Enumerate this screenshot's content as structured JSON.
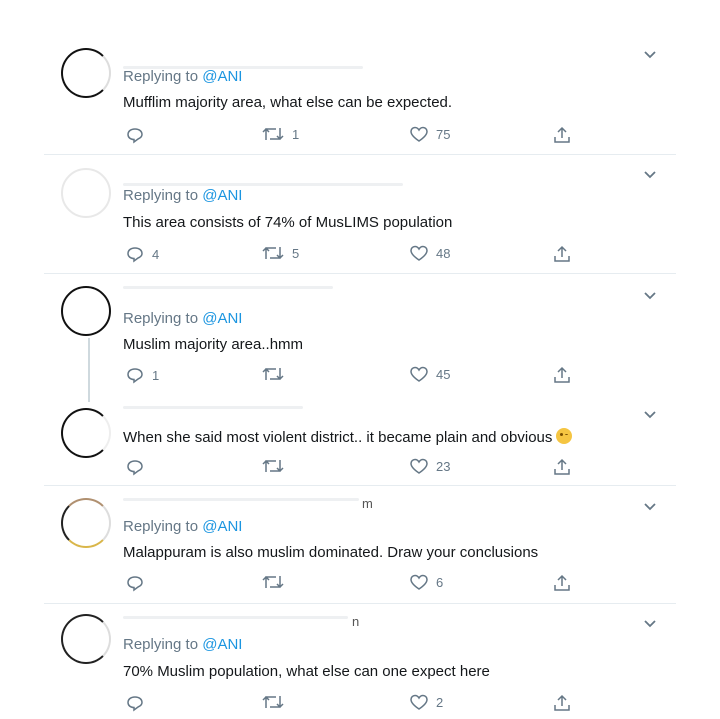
{
  "tweets": [
    {
      "replying_prefix": "Replying to ",
      "handle": "@ANI",
      "text": "Mufflim majority area, what else can be expected.",
      "replies": "",
      "retweets": "1",
      "likes": "75"
    },
    {
      "replying_prefix": "Replying to ",
      "handle": "@ANI",
      "text": "This area consists of 74% of MusLIMS population",
      "replies": "4",
      "retweets": "5",
      "likes": "48"
    },
    {
      "replying_prefix": "Replying to ",
      "handle": "@ANI",
      "text": "Muslim majority area..hmm",
      "replies": "1",
      "retweets": "",
      "likes": "45"
    },
    {
      "text": "When she said most violent district.. it became plain and obvious",
      "emoji": "winking-face-icon",
      "replies": "",
      "retweets": "",
      "likes": "23"
    },
    {
      "name_tail": "m",
      "replying_prefix": "Replying to ",
      "handle": "@ANI",
      "text": "Malappuram is also muslim dominated. Draw your conclusions",
      "replies": "",
      "retweets": "",
      "likes": "6"
    },
    {
      "name_tail": "n",
      "replying_prefix": "Replying to ",
      "handle": "@ANI",
      "text": "70% Muslim population, what else can one expect here",
      "replies": "",
      "retweets": "",
      "likes": "2"
    }
  ],
  "icons": {
    "reply": "reply-icon",
    "retweet": "retweet-icon",
    "like": "heart-icon",
    "share": "share-icon",
    "more": "chevron-down-icon"
  },
  "colors": {
    "link": "#1b95e0",
    "muted": "#657786",
    "divider": "#e6ecf0"
  }
}
